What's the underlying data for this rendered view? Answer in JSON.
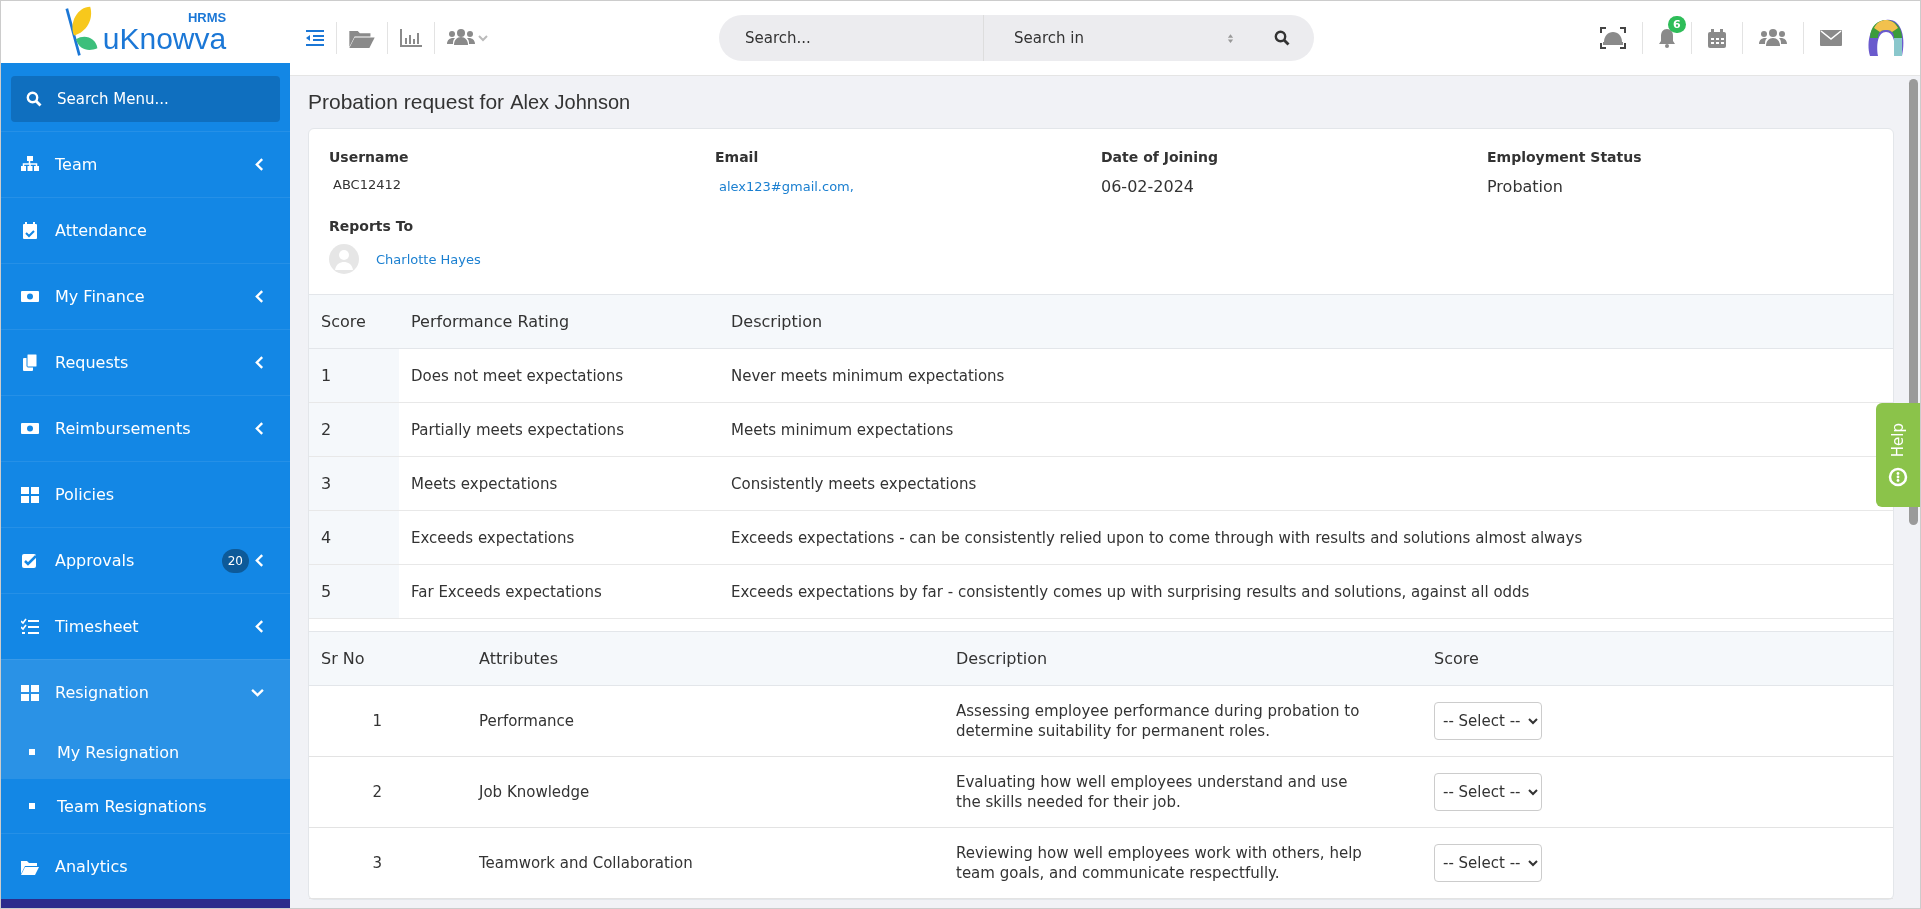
{
  "logo": {
    "brand": "uKnowva",
    "tag": "HRMS"
  },
  "toolbar": {
    "search_placeholder": "Search...",
    "search_in": "Search in",
    "notification_count": "6"
  },
  "sidebar": {
    "search_placeholder": "Search Menu...",
    "items": [
      {
        "label": "Team",
        "expanded": false,
        "selected": false
      },
      {
        "label": "Attendance",
        "selected": false
      },
      {
        "label": "My Finance",
        "expanded": false,
        "selected": false
      },
      {
        "label": "Requests",
        "expanded": false,
        "selected": false
      },
      {
        "label": "Reimbursements",
        "expanded": false,
        "selected": false
      },
      {
        "label": "Policies",
        "selected": false
      },
      {
        "label": "Approvals",
        "expanded": false,
        "badge": "20",
        "selected": false
      },
      {
        "label": "Timesheet",
        "expanded": false,
        "selected": false
      },
      {
        "label": "Resignation",
        "expanded": true,
        "selected": true,
        "children": [
          {
            "label": "My Resignation",
            "selected": true
          },
          {
            "label": "Team Resignations",
            "selected": false
          }
        ]
      },
      {
        "label": "Analytics",
        "selected": false
      }
    ]
  },
  "page": {
    "title": "Probation request for",
    "employee": "Alex Johnson"
  },
  "details": [
    {
      "label": "Username",
      "value": "ABC12412",
      "kind": "plain"
    },
    {
      "label": "Email",
      "value": "alex123#gmail.com,",
      "kind": "link"
    },
    {
      "label": "Date of Joining",
      "value": "06-02-2024",
      "kind": "large"
    },
    {
      "label": "Employment Status",
      "value": "Probation",
      "kind": "large"
    }
  ],
  "reports_to": {
    "label": "Reports To",
    "name": "Charlotte Hayes"
  },
  "rating_table": {
    "columns": [
      "Score",
      "Performance Rating",
      "Description"
    ],
    "rows": [
      [
        "1",
        "Does not meet expectations",
        "Never meets minimum expectations"
      ],
      [
        "2",
        "Partially meets expectations",
        "Meets minimum expectations"
      ],
      [
        "3",
        "Meets expectations",
        "Consistently meets expectations"
      ],
      [
        "4",
        "Exceeds expectations",
        "Exceeds expectations - can be consistently relied upon to come through with results and solutions almost always"
      ],
      [
        "5",
        "Far Exceeds expectations",
        "Exceeds expectations by far - consistently comes up with surprising results and solutions, against all odds"
      ]
    ]
  },
  "attributes_table": {
    "columns": [
      "Sr No",
      "Attributes",
      "Description",
      "Score"
    ],
    "rows": [
      {
        "sr": "1",
        "attribute": "Performance",
        "description": "Assessing employee performance during probation to determine suitability for permanent roles.",
        "score": "-- Select --"
      },
      {
        "sr": "2",
        "attribute": "Job Knowledge",
        "description": "Evaluating how well employees understand and use the skills needed for their job.",
        "score": "-- Select --"
      },
      {
        "sr": "3",
        "attribute": "Teamwork and Collaboration",
        "description": "Reviewing how well employees work with others, help team goals, and communicate respectfully.",
        "score": "-- Select --"
      }
    ]
  },
  "help": {
    "label": "Help"
  }
}
